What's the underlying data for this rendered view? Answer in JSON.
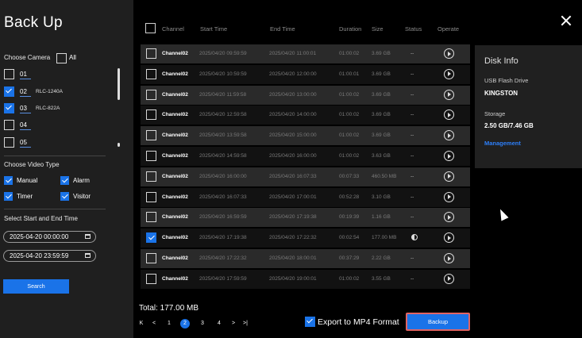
{
  "title": "Back Up",
  "camera": {
    "label": "Choose Camera",
    "all_label": "All",
    "items": [
      {
        "num": "01",
        "name": "",
        "checked": false
      },
      {
        "num": "02",
        "name": "RLC-1240A",
        "checked": true
      },
      {
        "num": "03",
        "name": "RLC-822A",
        "checked": true
      },
      {
        "num": "04",
        "name": "",
        "checked": false
      },
      {
        "num": "05",
        "name": "",
        "checked": false
      }
    ]
  },
  "video_type": {
    "label": "Choose Video Type",
    "manual": "Manual",
    "alarm": "Alarm",
    "timer": "Timer",
    "visitor": "Visitor"
  },
  "time_range": {
    "label": "Select Start and End Time",
    "start": "2025-04-20 00:00:00",
    "end": "2025-04-20 23:59:59"
  },
  "search_label": "Search",
  "table": {
    "headers": [
      "Channel",
      "Start Time",
      "End Time",
      "Duration",
      "Size",
      "Status",
      "Operate"
    ],
    "rows": [
      {
        "channel": "Channel02",
        "start": "2025/04/20 09:59:59",
        "end": "2025/04/20 11:00:01",
        "duration": "01:00:02",
        "size": "3.69 GB",
        "status": "--",
        "checked": false
      },
      {
        "channel": "Channel02",
        "start": "2025/04/20 10:59:59",
        "end": "2025/04/20 12:00:00",
        "duration": "01:00:01",
        "size": "3.69 GB",
        "status": "--",
        "checked": false
      },
      {
        "channel": "Channel02",
        "start": "2025/04/20 11:59:58",
        "end": "2025/04/20 13:00:00",
        "duration": "01:00:02",
        "size": "3.69 GB",
        "status": "--",
        "checked": false
      },
      {
        "channel": "Channel02",
        "start": "2025/04/20 12:59:58",
        "end": "2025/04/20 14:00:00",
        "duration": "01:00:02",
        "size": "3.69 GB",
        "status": "--",
        "checked": false
      },
      {
        "channel": "Channel02",
        "start": "2025/04/20 13:59:58",
        "end": "2025/04/20 15:00:00",
        "duration": "01:00:02",
        "size": "3.69 GB",
        "status": "--",
        "checked": false
      },
      {
        "channel": "Channel02",
        "start": "2025/04/20 14:59:58",
        "end": "2025/04/20 16:00:00",
        "duration": "01:00:02",
        "size": "3.63 GB",
        "status": "--",
        "checked": false
      },
      {
        "channel": "Channel02",
        "start": "2025/04/20 16:00:00",
        "end": "2025/04/20 16:07:33",
        "duration": "00:07:33",
        "size": "460.50 MB",
        "status": "--",
        "checked": false
      },
      {
        "channel": "Channel02",
        "start": "2025/04/20 16:07:33",
        "end": "2025/04/20 17:00:01",
        "duration": "00:52:28",
        "size": "3.10 GB",
        "status": "--",
        "checked": false
      },
      {
        "channel": "Channel02",
        "start": "2025/04/20 16:59:59",
        "end": "2025/04/20 17:19:38",
        "duration": "00:19:39",
        "size": "1.16 GB",
        "status": "--",
        "checked": false
      },
      {
        "channel": "Channel02",
        "start": "2025/04/20 17:19:38",
        "end": "2025/04/20 17:22:32",
        "duration": "00:02:54",
        "size": "177.00 MB",
        "status": "half-circle-icon",
        "checked": true
      },
      {
        "channel": "Channel02",
        "start": "2025/04/20 17:22:32",
        "end": "2025/04/20 18:00:01",
        "duration": "00:37:29",
        "size": "2.22 GB",
        "status": "--",
        "checked": false
      },
      {
        "channel": "Channel02",
        "start": "2025/04/20 17:59:59",
        "end": "2025/04/20 19:00:01",
        "duration": "01:00:02",
        "size": "3.55 GB",
        "status": "--",
        "checked": false
      }
    ]
  },
  "disk": {
    "title": "Disk Info",
    "device": "USB Flash Drive",
    "name": "KINGSTON",
    "storage_label": "Storage",
    "storage_value": "2.50 GB/7.46 GB",
    "management": "Management"
  },
  "total": "Total: 177.00 MB",
  "pagination": {
    "first": "K",
    "prev": "<",
    "pages": [
      "1",
      "2",
      "3",
      "4"
    ],
    "active": "2",
    "next": ">",
    "last": ">|"
  },
  "export_label": "Export to MP4 Format",
  "backup_label": "Backup",
  "colors": {
    "accent": "#1a73e8",
    "highlight_border": "#e06464"
  }
}
